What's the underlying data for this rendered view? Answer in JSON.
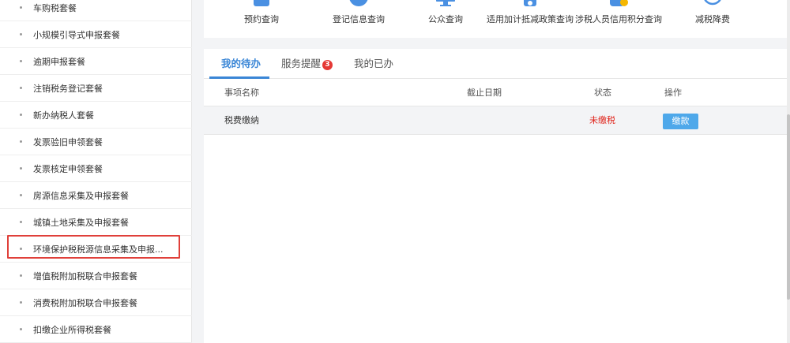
{
  "sidebar": {
    "items": [
      {
        "label": "车购税套餐"
      },
      {
        "label": "小规模引导式申报套餐"
      },
      {
        "label": "逾期申报套餐"
      },
      {
        "label": "注销税务登记套餐"
      },
      {
        "label": "新办纳税人套餐"
      },
      {
        "label": "发票验旧申领套餐"
      },
      {
        "label": "发票核定申领套餐"
      },
      {
        "label": "房源信息采集及申报套餐"
      },
      {
        "label": "城镇土地采集及申报套餐"
      },
      {
        "label": "环境保护税税源信息采集及申报..."
      },
      {
        "label": "增值税附加税联合申报套餐"
      },
      {
        "label": "消费税附加税联合申报套餐"
      },
      {
        "label": "扣缴企业所得税套餐"
      }
    ],
    "highlighted_index": 9
  },
  "quick_access": [
    {
      "label": "预约查询",
      "icon": "calendar-search-icon"
    },
    {
      "label": "登记信息查询",
      "icon": "registration-info-icon"
    },
    {
      "label": "公众查询",
      "icon": "monitor-icon"
    },
    {
      "label": "适用加计抵减政策查询",
      "icon": "document-icon"
    },
    {
      "label": "涉税人员信用积分查询",
      "icon": "user-credit-icon"
    },
    {
      "label": "减税降费",
      "icon": "tax-reduction-icon"
    }
  ],
  "tabs": [
    {
      "label": "我的待办",
      "active": true
    },
    {
      "label": "服务提醒",
      "badge": "3"
    },
    {
      "label": "我的已办"
    }
  ],
  "table": {
    "headers": [
      "事项名称",
      "截止日期",
      "状态",
      "操作"
    ],
    "rows": [
      {
        "name": "税费缴纳",
        "deadline": "",
        "status": "未缴税",
        "action": "缴款"
      }
    ]
  },
  "colors": {
    "accent": "#3a86d6",
    "status_unpaid": "#e0251c",
    "button": "#4ea8ea",
    "highlight_border": "#e0403a"
  }
}
